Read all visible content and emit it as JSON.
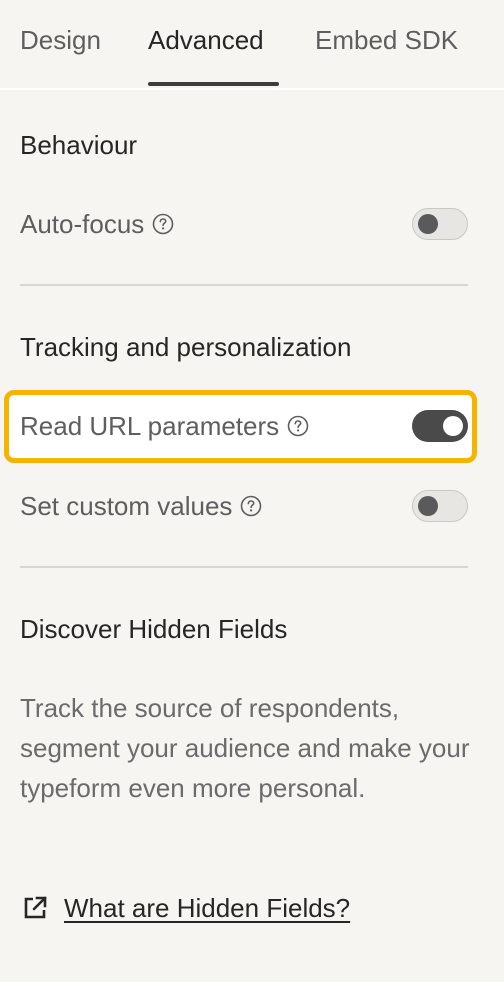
{
  "tabs": [
    {
      "label": "Design",
      "active": false
    },
    {
      "label": "Advanced",
      "active": true
    },
    {
      "label": "Embed SDK",
      "active": false
    }
  ],
  "behaviour": {
    "title": "Behaviour",
    "auto_focus": {
      "label": "Auto-focus",
      "enabled": false
    }
  },
  "tracking": {
    "title": "Tracking and personalization",
    "read_url_parameters": {
      "label": "Read URL parameters",
      "enabled": true
    },
    "set_custom_values": {
      "label": "Set custom values",
      "enabled": false
    }
  },
  "discover": {
    "title": "Discover Hidden Fields",
    "description": "Track the source of respondents, segment your audience and make your typeform even more personal.",
    "link_label": "What are Hidden Fields?"
  },
  "colors": {
    "background": "#f6f5f2",
    "highlight": "#f6b400",
    "toggle_on": "#4a4a4b",
    "toggle_off": "#e7e6e2"
  },
  "icons": {
    "help": "question-circle-icon",
    "external_link": "external-link-icon"
  }
}
